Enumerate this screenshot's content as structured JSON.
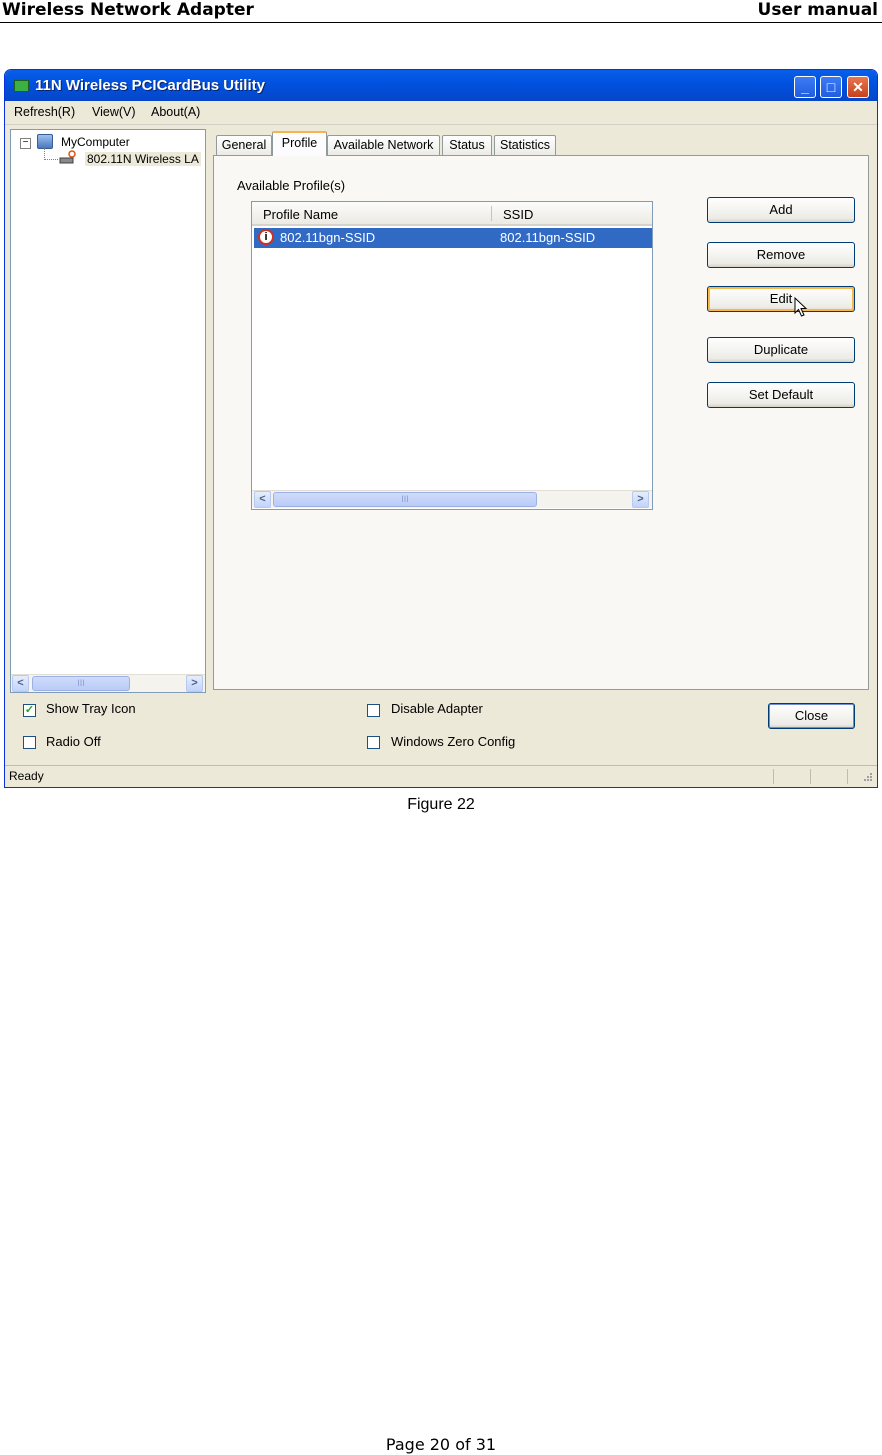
{
  "doc": {
    "header_left": "Wireless Network Adapter",
    "header_right": "User manual",
    "caption": "Figure 22",
    "footer": "Page 20 of 31"
  },
  "window": {
    "title": "11N Wireless PCICardBus Utility",
    "menu": [
      "Refresh(R)",
      "View(V)",
      "About(A)"
    ],
    "tree": {
      "root": "MyComputer",
      "child": "802.11N Wireless LA"
    },
    "tabs": [
      "General",
      "Profile",
      "Available Network",
      "Status",
      "Statistics"
    ],
    "active_tab": "Profile",
    "profile": {
      "section_label": "Available Profile(s)",
      "columns": [
        "Profile Name",
        "SSID"
      ],
      "rows": [
        {
          "profile_name": "802.11bgn-SSID",
          "ssid": "802.11bgn-SSID"
        }
      ],
      "buttons": [
        "Add",
        "Remove",
        "Edit",
        "Duplicate",
        "Set Default"
      ]
    },
    "options": {
      "show_tray_icon": {
        "label": "Show Tray Icon",
        "checked": true
      },
      "radio_off": {
        "label": "Radio Off",
        "checked": false
      },
      "disable_adapter": {
        "label": "Disable Adapter",
        "checked": false
      },
      "windows_zero_config": {
        "label": "Windows Zero Config",
        "checked": false
      }
    },
    "close_label": "Close",
    "status": "Ready",
    "scroll_thumb_glyph": "III",
    "icons": [
      "app-icon",
      "minimize-icon",
      "maximize-icon",
      "close-icon",
      "computer-icon",
      "wireless-adapter-icon",
      "profile-info-icon",
      "mouse-cursor-icon",
      "checkmark-icon",
      "chevron-left-icon",
      "chevron-right-icon",
      "resize-grip-icon"
    ],
    "colors": {
      "selection": "#316ac5",
      "titlebar": "#0052e0",
      "face": "#ece9d8",
      "focus": "#f8b94a"
    }
  }
}
